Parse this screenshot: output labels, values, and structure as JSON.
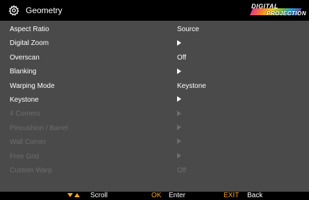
{
  "header": {
    "title": "Geometry",
    "icon": "gear-icon",
    "logo_line1": "DIGITAL",
    "logo_line2": "PROJECTION"
  },
  "menu": {
    "items": [
      {
        "label": "Aspect Ratio",
        "value": "Source",
        "enabled": true,
        "submenu": false
      },
      {
        "label": "Digital Zoom",
        "value": "",
        "enabled": true,
        "submenu": true
      },
      {
        "label": "Overscan",
        "value": "Off",
        "enabled": true,
        "submenu": false
      },
      {
        "label": "Blanking",
        "value": "",
        "enabled": true,
        "submenu": true
      },
      {
        "label": "Warping Mode",
        "value": "Keystone",
        "enabled": true,
        "submenu": false
      },
      {
        "label": "Keystone",
        "value": "",
        "enabled": true,
        "submenu": true
      },
      {
        "label": "4 Corners",
        "value": "",
        "enabled": false,
        "submenu": true
      },
      {
        "label": "Pincushion / Barrel",
        "value": "",
        "enabled": false,
        "submenu": true
      },
      {
        "label": "Wall Corner",
        "value": "",
        "enabled": false,
        "submenu": true
      },
      {
        "label": "Free Grid",
        "value": "",
        "enabled": false,
        "submenu": true
      },
      {
        "label": "Custom Warp",
        "value": "Off",
        "enabled": false,
        "submenu": false
      }
    ]
  },
  "footer": {
    "scroll_label": "Scroll",
    "ok_key": "OK",
    "ok_label": "Enter",
    "exit_key": "EXIT",
    "exit_label": "Back"
  },
  "colors": {
    "background": "#4a4a4a",
    "bar": "#000000",
    "text_enabled": "#ffffff",
    "text_disabled": "#6e6e6e",
    "key_accent": "#f5a623"
  }
}
